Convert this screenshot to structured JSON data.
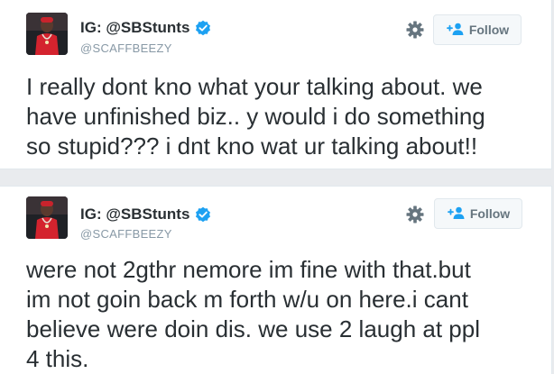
{
  "tweets": [
    {
      "display_name": "IG: @SBStunts",
      "handle": "@SCAFFBEEZY",
      "follow_label": "Follow",
      "text_lines": [
        "I really dont kno what your talking about. we",
        "have unfinished biz.. y would i do something",
        "so stupid??? i dnt kno wat ur talking about!!"
      ]
    },
    {
      "display_name": "IG: @SBStunts",
      "handle": "@SCAFFBEEZY",
      "follow_label": "Follow",
      "text_lines": [
        "were not 2gthr nemore im fine with that.but",
        "im not goin back m forth w/u on here.i cant",
        "believe were doin dis. we use 2 laugh at ppl",
        "4 this."
      ]
    }
  ],
  "icons": {
    "verified": "verified-badge-icon",
    "settings": "gear-icon",
    "follow": "add-person-icon"
  },
  "colors": {
    "verified_blue": "#1da1f2",
    "text": "#292f33",
    "muted": "#8899a6"
  }
}
